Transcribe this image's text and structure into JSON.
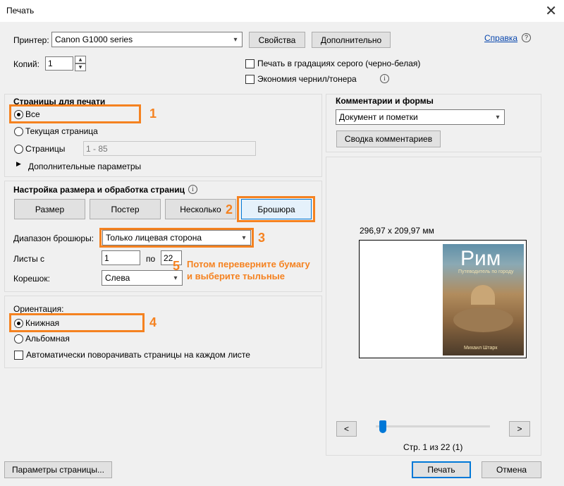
{
  "window": {
    "title": "Печать",
    "close_glyph": "✕"
  },
  "printer": {
    "label": "Принтер:",
    "selected": "Canon G1000 series",
    "properties_button": "Свойства",
    "advanced_button": "Дополнительно",
    "help_link": "Справка",
    "copies_label": "Копий:",
    "copies_value": "1",
    "grayscale_label": "Печать в градациях серого (черно-белая)",
    "save_ink_label": "Экономия чернил/тонера"
  },
  "pages": {
    "heading": "Страницы для печати",
    "all_label": "Все",
    "current_label": "Текущая страница",
    "pages_label": "Страницы",
    "pages_value": "1 - 85",
    "more_options": "Дополнительные параметры"
  },
  "sizing": {
    "heading": "Настройка размера и обработка страниц",
    "size_button": "Размер",
    "poster_button": "Постер",
    "multiple_button": "Несколько",
    "booklet_button": "Брошюра",
    "range_label": "Диапазон брошюры:",
    "range_value": "Только лицевая сторона",
    "sheets_from_label": "Листы с",
    "sheets_from_value": "1",
    "sheets_to_label": "по",
    "sheets_to_value": "22",
    "binding_label": "Корешок:",
    "binding_value": "Слева"
  },
  "orientation": {
    "heading": "Ориентация:",
    "portrait_label": "Книжная",
    "landscape_label": "Альбомная",
    "auto_rotate_label": "Автоматически поворачивать страницы на каждом листе"
  },
  "comments": {
    "heading": "Комментарии и формы",
    "selected": "Документ и пометки",
    "summary_button": "Сводка комментариев"
  },
  "preview": {
    "size_text": "296,97 x 209,97 мм",
    "cover_title": "Рим",
    "cover_subtitle": "Путеводитель по городу",
    "cover_author": "Михаил Штарк",
    "prev_button": "<",
    "next_button": ">",
    "page_indicator": "Стр. 1 из 22 (1)",
    "slider_position": 0.03
  },
  "footer": {
    "page_setup_button": "Параметры страницы...",
    "print_button": "Печать",
    "cancel_button": "Отмена"
  },
  "annotations": {
    "n1": "1",
    "n2": "2",
    "n3": "3",
    "n4": "4",
    "n5": "5",
    "note_line1": "Потом переверните бумагу",
    "note_line2": "и выберите тыльные",
    "color": "#f58220"
  },
  "icons": {
    "help": "help-circle-icon",
    "info": "info-icon",
    "expand": "triangle-right-icon",
    "dropdown": "chevron-down-icon"
  }
}
